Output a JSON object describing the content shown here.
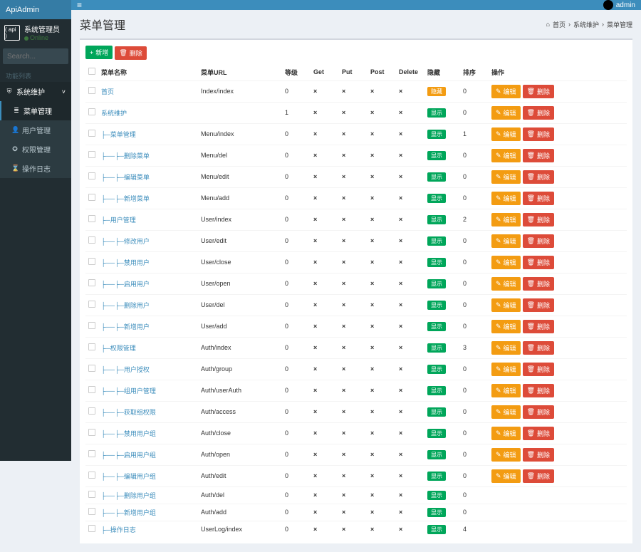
{
  "brand": "ApiAdmin",
  "user": {
    "role": "系统管理员",
    "status": "Online",
    "avatar_text": "( api )"
  },
  "search": {
    "placeholder": "Search..."
  },
  "nav_header": "功能列表",
  "sidebar": [
    {
      "icon": "⛨",
      "label": "系统维护",
      "open": true,
      "children": [
        {
          "icon": "≣",
          "label": "菜单管理",
          "active": true
        },
        {
          "icon": "👤",
          "label": "用户管理"
        },
        {
          "icon": "✪",
          "label": "权限管理"
        },
        {
          "icon": "⌛",
          "label": "操作日志"
        }
      ]
    }
  ],
  "topbar": {
    "user_label": "admin"
  },
  "page": {
    "title": "菜单管理"
  },
  "breadcrumb": {
    "home": "首页",
    "section": "系统维护",
    "current": "菜单管理"
  },
  "toolbar": {
    "add": "新增",
    "del": "删除"
  },
  "table": {
    "headers": {
      "name": "菜单名称",
      "url": "菜单URL",
      "level": "等级",
      "get": "Get",
      "put": "Put",
      "post": "Post",
      "delete": "Delete",
      "hide": "隐藏",
      "sort": "排序",
      "ops": "操作"
    },
    "hide_labels": {
      "hidden": "隐藏",
      "visible": "显示"
    },
    "op_labels": {
      "edit": "编辑",
      "del": "删除"
    },
    "rows": [
      {
        "name": "首页",
        "url": "Index/index",
        "level": "0",
        "hide": "hidden",
        "sort": "0",
        "show_ops": true
      },
      {
        "name": "系统维护",
        "url": "",
        "level": "1",
        "hide": "visible",
        "sort": "0",
        "show_ops": true
      },
      {
        "name": "├─菜单管理",
        "url": "Menu/index",
        "level": "0",
        "hide": "visible",
        "sort": "1",
        "show_ops": true
      },
      {
        "name": "├──├─删除菜单",
        "url": "Menu/del",
        "level": "0",
        "hide": "visible",
        "sort": "0",
        "show_ops": true
      },
      {
        "name": "├──├─编辑菜单",
        "url": "Menu/edit",
        "level": "0",
        "hide": "visible",
        "sort": "0",
        "show_ops": true
      },
      {
        "name": "├──├─新增菜单",
        "url": "Menu/add",
        "level": "0",
        "hide": "visible",
        "sort": "0",
        "show_ops": true
      },
      {
        "name": "├─用户管理",
        "url": "User/index",
        "level": "0",
        "hide": "visible",
        "sort": "2",
        "show_ops": true
      },
      {
        "name": "├──├─修改用户",
        "url": "User/edit",
        "level": "0",
        "hide": "visible",
        "sort": "0",
        "show_ops": true
      },
      {
        "name": "├──├─禁用用户",
        "url": "User/close",
        "level": "0",
        "hide": "visible",
        "sort": "0",
        "show_ops": true
      },
      {
        "name": "├──├─启用用户",
        "url": "User/open",
        "level": "0",
        "hide": "visible",
        "sort": "0",
        "show_ops": true
      },
      {
        "name": "├──├─删除用户",
        "url": "User/del",
        "level": "0",
        "hide": "visible",
        "sort": "0",
        "show_ops": true
      },
      {
        "name": "├──├─新增用户",
        "url": "User/add",
        "level": "0",
        "hide": "visible",
        "sort": "0",
        "show_ops": true
      },
      {
        "name": "├─权限管理",
        "url": "Auth/index",
        "level": "0",
        "hide": "visible",
        "sort": "3",
        "show_ops": true
      },
      {
        "name": "├──├─用户授权",
        "url": "Auth/group",
        "level": "0",
        "hide": "visible",
        "sort": "0",
        "show_ops": true
      },
      {
        "name": "├──├─组用户管理",
        "url": "Auth/userAuth",
        "level": "0",
        "hide": "visible",
        "sort": "0",
        "show_ops": true
      },
      {
        "name": "├──├─获取组权限",
        "url": "Auth/access",
        "level": "0",
        "hide": "visible",
        "sort": "0",
        "show_ops": true
      },
      {
        "name": "├──├─禁用用户组",
        "url": "Auth/close",
        "level": "0",
        "hide": "visible",
        "sort": "0",
        "show_ops": true
      },
      {
        "name": "├──├─启用用户组",
        "url": "Auth/open",
        "level": "0",
        "hide": "visible",
        "sort": "0",
        "show_ops": true
      },
      {
        "name": "├──├─编辑用户组",
        "url": "Auth/edit",
        "level": "0",
        "hide": "visible",
        "sort": "0",
        "show_ops": true
      },
      {
        "name": "├──├─删除用户组",
        "url": "Auth/del",
        "level": "0",
        "hide": "visible",
        "sort": "0",
        "show_ops": false
      },
      {
        "name": "├──├─新增用户组",
        "url": "Auth/add",
        "level": "0",
        "hide": "visible",
        "sort": "0",
        "show_ops": false
      },
      {
        "name": "├─操作日志",
        "url": "UserLog/index",
        "level": "0",
        "hide": "visible",
        "sort": "4",
        "show_ops": false
      }
    ]
  }
}
